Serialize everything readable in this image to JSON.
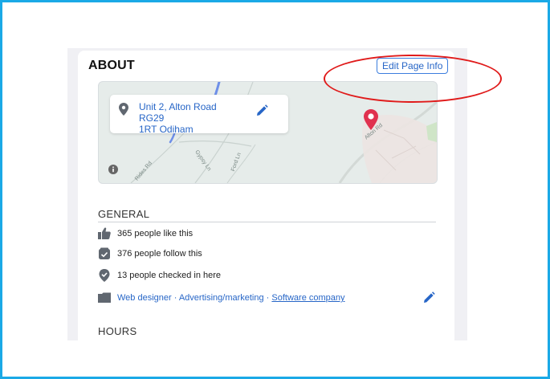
{
  "about": {
    "title": "ABOUT",
    "edit_button": "Edit Page Info"
  },
  "map": {
    "address_line1": "Unit 2, Alton Road RG29",
    "address_line2": "1RT Odiham",
    "road_labels": [
      "Alton Rd",
      "Ford Ln",
      "Gypsy Ln",
      "Rides Rd"
    ]
  },
  "general": {
    "title": "GENERAL",
    "likes": "365 people like this",
    "follows": "376 people follow this",
    "checkins": "13 people checked in here",
    "categories": {
      "item1": "Web designer",
      "sep1": " · ",
      "item2": "Advertising/marketing",
      "sep2": " · ",
      "item3": "Software company"
    }
  },
  "hours": {
    "title": "HOURS"
  },
  "colors": {
    "frame": "#1aa9e6",
    "link": "#2766c7",
    "highlight": "#e01b1b",
    "marker": "#e0314f"
  },
  "icons": [
    "location-pin-icon",
    "pencil-icon",
    "info-icon",
    "map-marker-icon",
    "thumbs-up-icon",
    "follow-icon",
    "check-in-icon",
    "category-icon"
  ]
}
